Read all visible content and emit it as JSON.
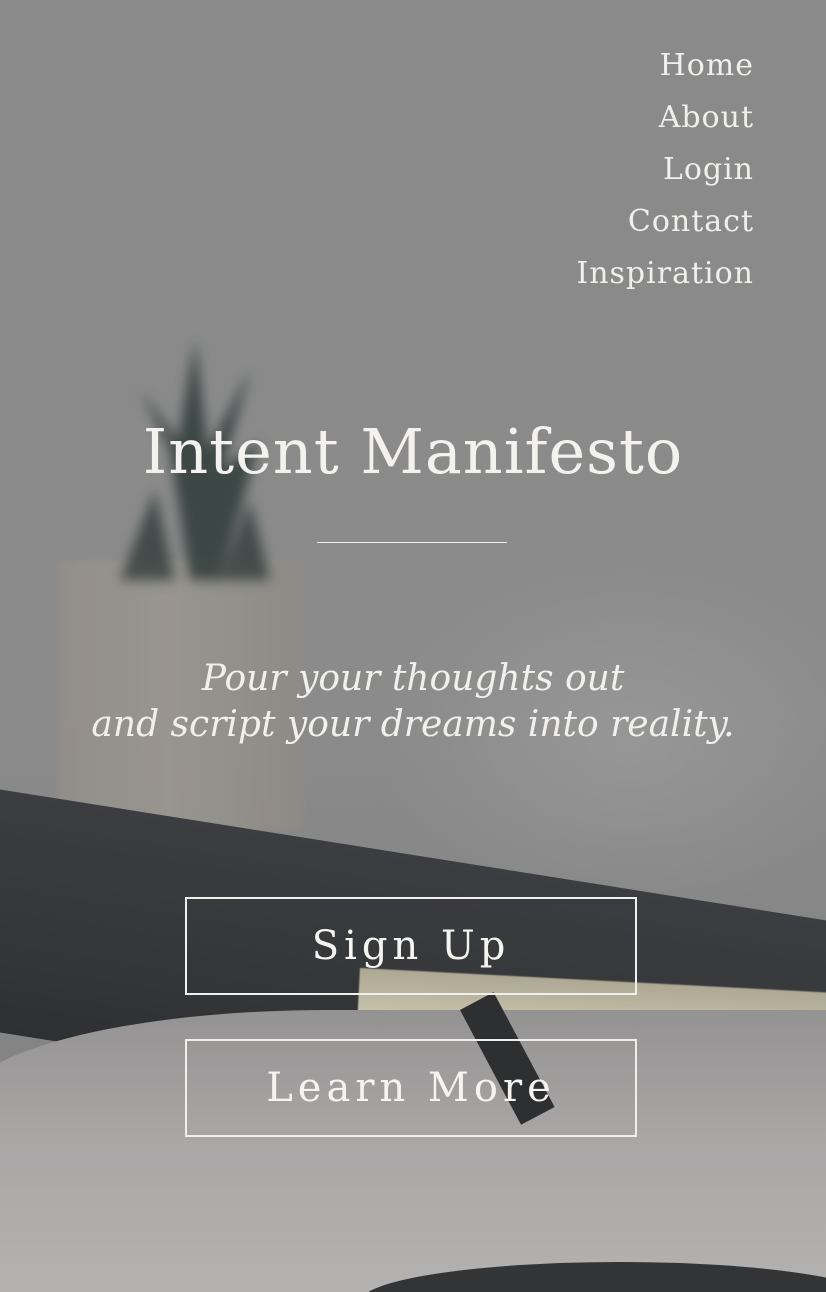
{
  "nav": {
    "items": [
      {
        "label": "Home"
      },
      {
        "label": "About"
      },
      {
        "label": "Login"
      },
      {
        "label": "Contact"
      },
      {
        "label": "Inspiration"
      }
    ]
  },
  "hero": {
    "title": "Intent Manifesto",
    "tagline_line1": "Pour your thoughts out",
    "tagline_line2": "and script your dreams into reality."
  },
  "buttons": {
    "signup_label": "Sign Up",
    "learn_more_label": "Learn More"
  },
  "colors": {
    "text": "#f3f1ee",
    "overlay": "#8a8a8a"
  }
}
